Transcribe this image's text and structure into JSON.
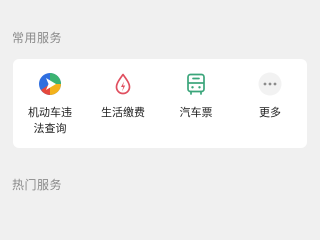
{
  "sections": {
    "common_title": "常用服务",
    "hot_title": "热门服务"
  },
  "services": [
    {
      "label": "机动车违法查询",
      "icon": "navigation-pin-icon"
    },
    {
      "label": "生活缴费",
      "icon": "water-drop-bolt-icon"
    },
    {
      "label": "汽车票",
      "icon": "bus-icon"
    },
    {
      "label": "更多",
      "icon": "more-dots-icon"
    }
  ],
  "colors": {
    "background": "#f0f0f0",
    "card": "#ffffff",
    "section_text": "#8a8a8a",
    "utility_red": "#e04f5f",
    "bus_green": "#3aa57a",
    "more_gray": "#b3b3b3"
  }
}
